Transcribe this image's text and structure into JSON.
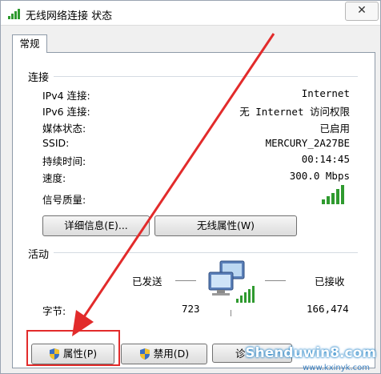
{
  "window": {
    "title": "无线网络连接 状态",
    "close_glyph": "✕"
  },
  "tabs": [
    {
      "label": "常规"
    }
  ],
  "connection": {
    "heading": "连接",
    "rows": [
      {
        "label": "IPv4 连接:",
        "value": "Internet"
      },
      {
        "label": "IPv6 连接:",
        "value": "无 Internet 访问权限"
      },
      {
        "label": "媒体状态:",
        "value": "已启用"
      },
      {
        "label": "SSID:",
        "value": "MERCURY_2A27BE"
      },
      {
        "label": "持续时间:",
        "value": "00:14:45"
      },
      {
        "label": "速度:",
        "value": "300.0 Mbps"
      }
    ],
    "signal_label": "信号质量:",
    "signal_icon": "signal-bars-icon",
    "details_button": "详细信息(E)...",
    "wireless_props_button": "无线属性(W)"
  },
  "activity": {
    "heading": "活动",
    "sent_label": "已发送",
    "received_label": "已接收",
    "bytes_label": "字节:",
    "bytes_sent": "723",
    "bytes_received": "166,474",
    "network_icon": "network-computers-icon"
  },
  "footer": {
    "properties_button": "属性(P)",
    "disable_button": "禁用(D)",
    "diagnose_button_partial": "诊"
  },
  "annotation": {
    "arrow_color": "#e22b2b",
    "highlight_color": "#e22b2b"
  },
  "watermark": {
    "text": "Shenduwin8.com",
    "url": "www.kxinyk.com"
  }
}
